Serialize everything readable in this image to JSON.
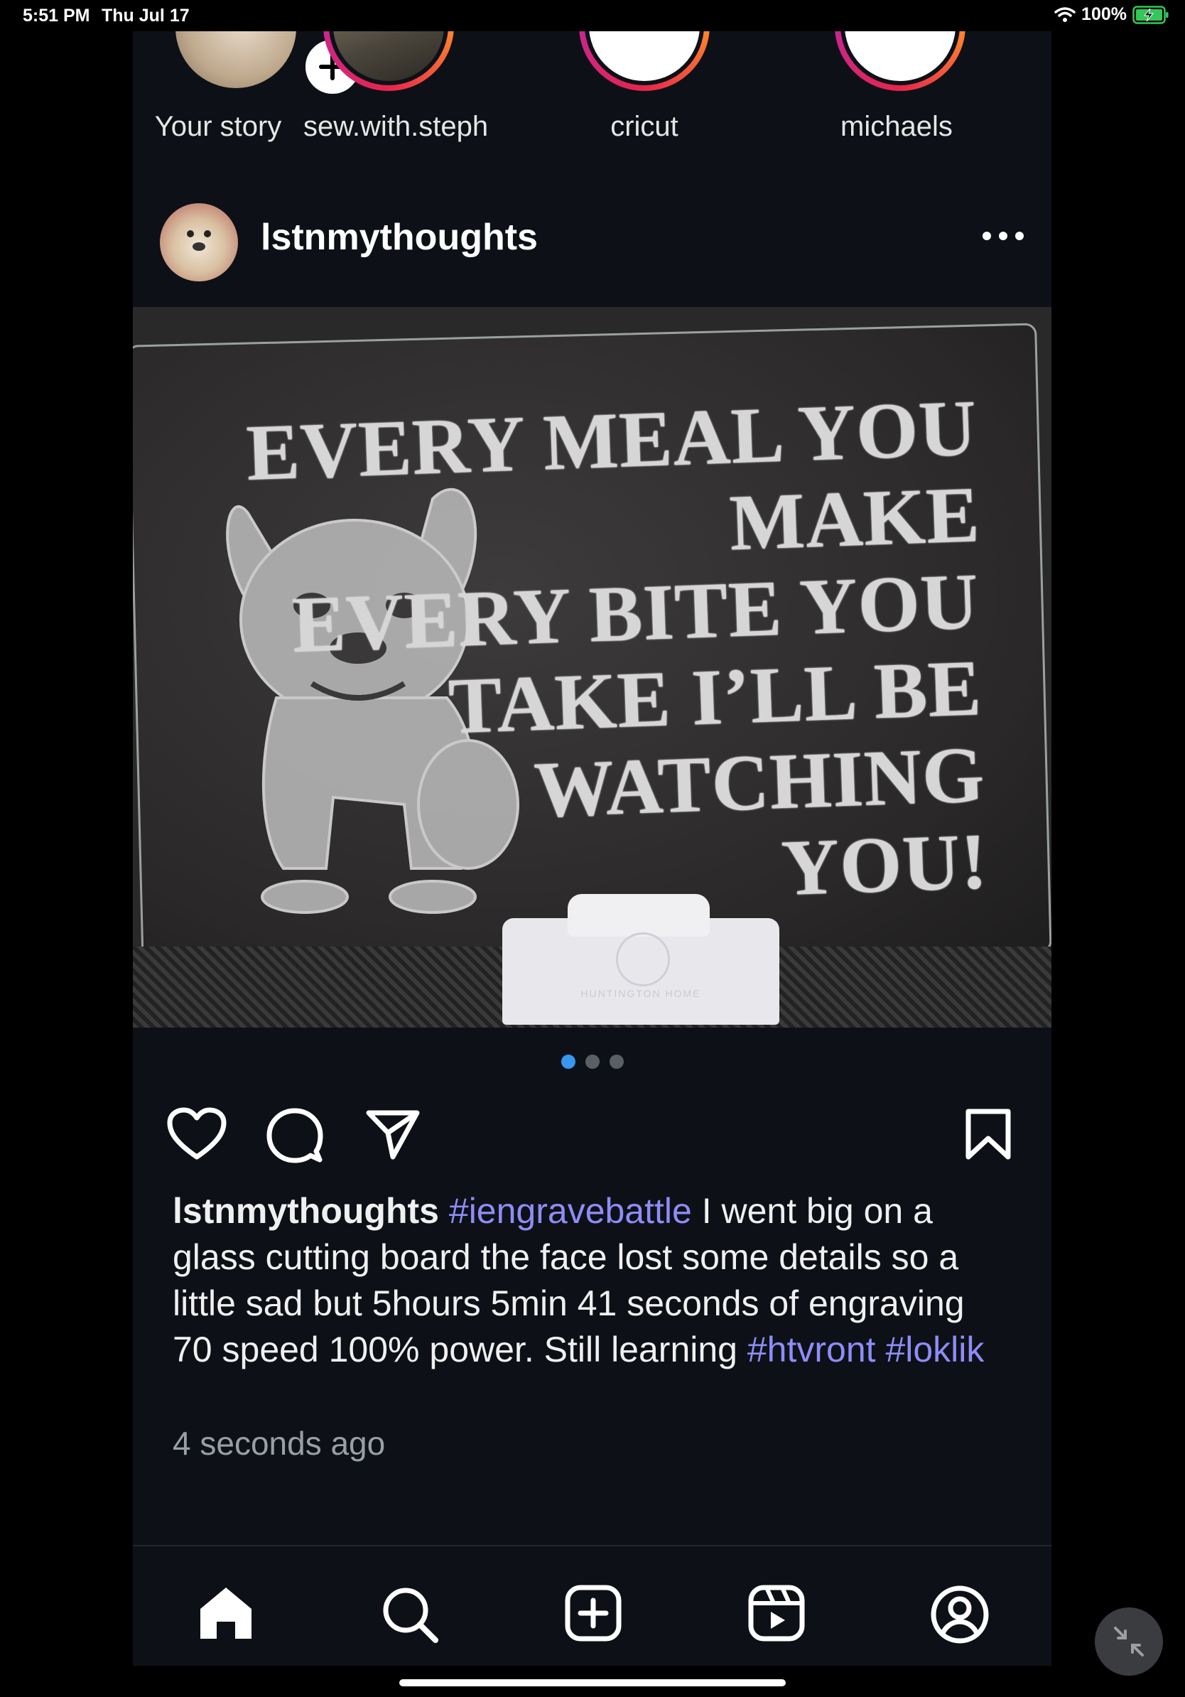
{
  "status_bar": {
    "time": "5:51 PM",
    "date": "Thu Jul 17",
    "battery": "100%"
  },
  "stories": [
    {
      "label": "Your story"
    },
    {
      "label": "sew.with.steph"
    },
    {
      "label": "cricut"
    },
    {
      "label": "michaels"
    }
  ],
  "post": {
    "username": "lstnmythoughts",
    "image_text": [
      "EVERY MEAL YOU MAKE",
      "EVERY BITE YOU",
      "TAKE I’LL BE",
      "WATCHING",
      "YOU!"
    ],
    "stand_brand": "HUNTINGTON HOME",
    "carousel": {
      "count": 3,
      "active": 0
    },
    "caption": {
      "username": "lstnmythoughts",
      "tag1": "#iengravebattle",
      "text": " I went big on a glass cutting board the face lost some details so a little sad but 5hours 5min 41 seconds of engraving 70 speed 100% power. Still learning ",
      "tag2": "#htvront",
      "tag3": "#loklik"
    },
    "time_ago": "4 seconds ago"
  },
  "tabbar": [
    "home-icon",
    "search-icon",
    "create-icon",
    "reels-icon",
    "profile-icon"
  ],
  "colors": {
    "accent": "#3897f0",
    "hashtag": "#8f8cf7",
    "background": "#0d1117"
  }
}
